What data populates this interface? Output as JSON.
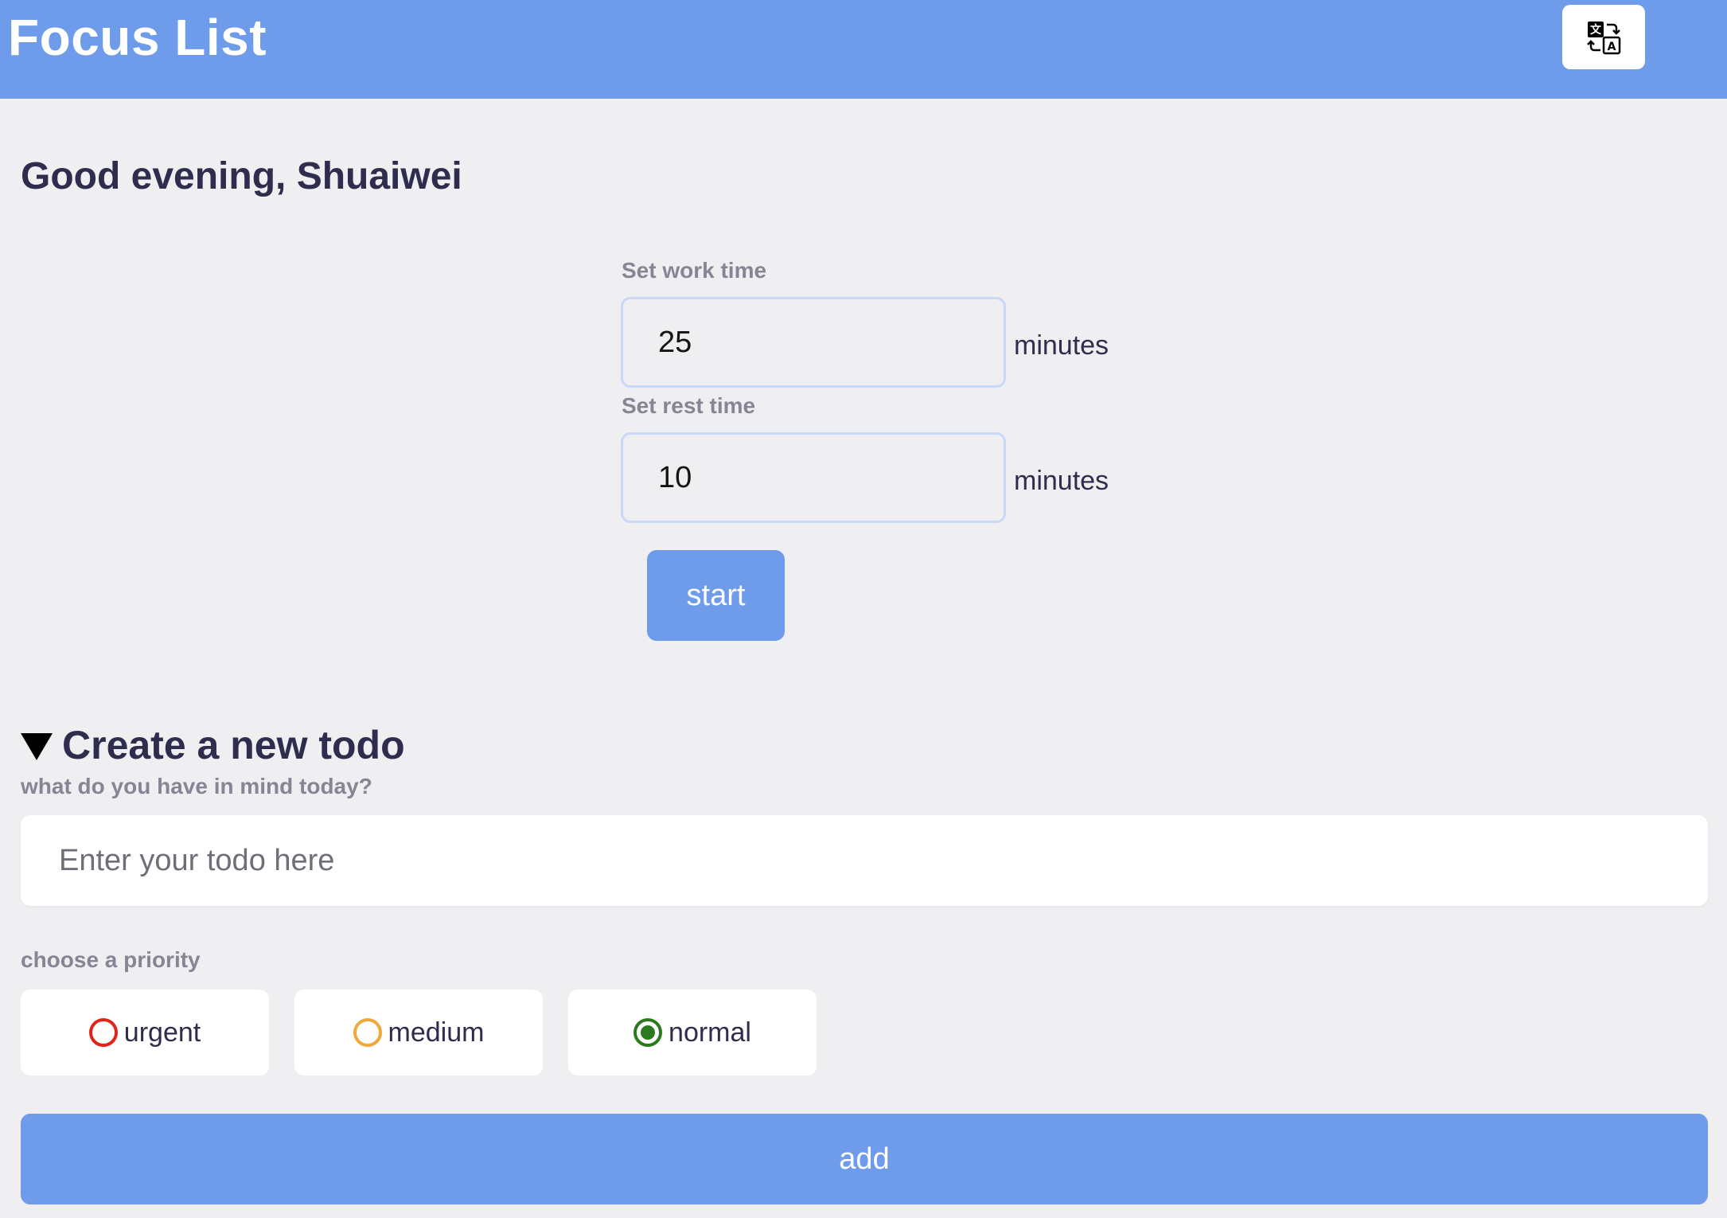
{
  "header": {
    "title": "Focus List",
    "language_icon": "translate-icon"
  },
  "greeting": "Good evening, Shuaiwei",
  "timer": {
    "work_label": "Set work time",
    "work_value": "25",
    "work_unit": "minutes",
    "rest_label": "Set rest time",
    "rest_value": "10",
    "rest_unit": "minutes",
    "start_label": "start"
  },
  "todo": {
    "section_title": "Create a new todo",
    "section_icon": "triangle-down-icon",
    "prompt": "what do you have in mind today?",
    "input_placeholder": "Enter your todo here",
    "input_value": "",
    "priority_label": "choose a priority",
    "priorities": [
      {
        "label": "urgent",
        "color": "#e0241b",
        "checked": false
      },
      {
        "label": "medium",
        "color": "#f1a83a",
        "checked": false
      },
      {
        "label": "normal",
        "color": "#2c7a1e",
        "checked": true
      }
    ],
    "add_label": "add"
  },
  "colors": {
    "accent": "#6e9bea",
    "background": "#efeef1",
    "text": "#2e2d4d",
    "muted_text": "#858595"
  }
}
